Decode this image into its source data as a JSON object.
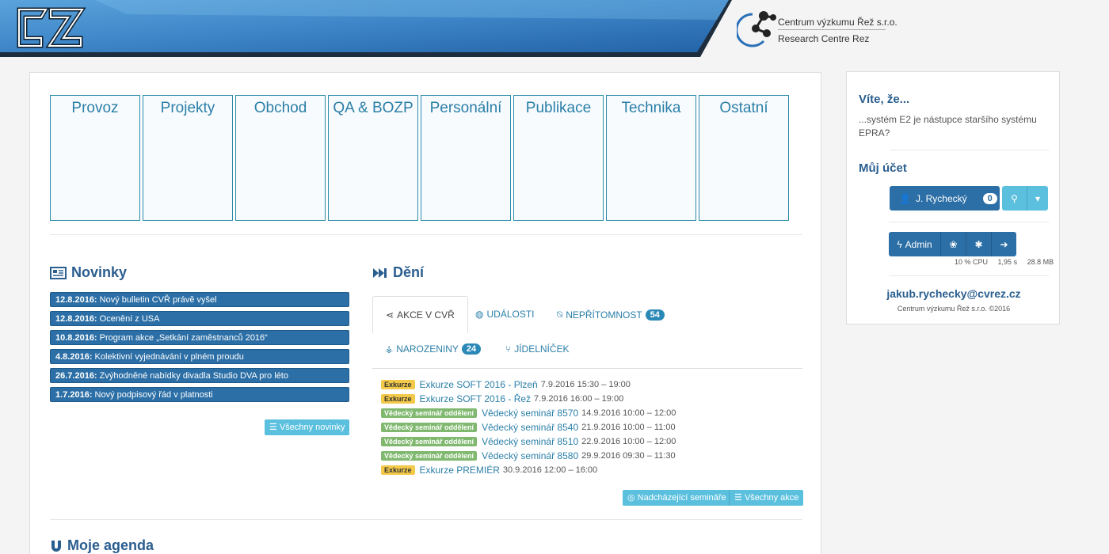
{
  "header": {
    "logo_text": "EZ",
    "partner_name_cz": "Centrum výzkumu Řež s.r.o.",
    "partner_name_en": "Research Centre Rez"
  },
  "tiles": [
    "Provoz",
    "Projekty",
    "Obchod",
    "QA & BOZP",
    "Personální",
    "Publikace",
    "Technika",
    "Ostatní"
  ],
  "novinky": {
    "title": "Novinky",
    "items": [
      {
        "date": "12.8.2016:",
        "text": "Nový bulletin CVŘ právě vyšel"
      },
      {
        "date": "12.8.2016:",
        "text": "Ocenění z USA"
      },
      {
        "date": "10.8.2016:",
        "text": "Program akce „Setkání zaměstnanců 2016“"
      },
      {
        "date": "4.8.2016:",
        "text": "Kolektivní vyjednávání v plném proudu"
      },
      {
        "date": "26.7.2016:",
        "text": "Zvýhodněné nabídky divadla Studio DVA pro léto"
      },
      {
        "date": "1.7.2016:",
        "text": "Nový podpisový řád v platnosti"
      }
    ],
    "all_button": "Všechny novinky"
  },
  "deni": {
    "title": "Dění",
    "tabs": {
      "akce": "AKCE V CVŘ",
      "udalosti": "UDÁLOSTI",
      "nepritomnost": "NEPŘÍTOMNOST",
      "nepritomnost_count": "54",
      "narozeniny": "NAROZENINY",
      "narozeniny_count": "24",
      "jidelnicek": "JÍDELNÍČEK"
    },
    "events": [
      {
        "type": "exk",
        "label": "Exkurze",
        "link": "Exkurze SOFT 2016 - Plzeň",
        "date": "7.9.2016 15:30 – 19:00"
      },
      {
        "type": "exk",
        "label": "Exkurze",
        "link": "Exkurze SOFT 2016 - Řež",
        "date": "7.9.2016 16:00 – 19:00"
      },
      {
        "type": "sem",
        "label": "Vědecký seminář oddělení",
        "link": "Vědecký seminář 8570",
        "date": "14.9.2016 10:00 – 12:00"
      },
      {
        "type": "sem",
        "label": "Vědecký seminář oddělení",
        "link": "Vědecký seminář 8540",
        "date": "21.9.2016 10:00 – 11:00"
      },
      {
        "type": "sem",
        "label": "Vědecký seminář oddělení",
        "link": "Vědecký seminář 8510",
        "date": "22.9.2016 10:00 – 12:00"
      },
      {
        "type": "sem",
        "label": "Vědecký seminář oddělení",
        "link": "Vědecký seminář 8580",
        "date": "29.9.2016 09:30 – 11:30"
      },
      {
        "type": "exk",
        "label": "Exkurze",
        "link": "Exkurze PREMIÉR",
        "date": "30.9.2016 12:00 – 16:00"
      }
    ],
    "upcoming_button": "Nadcházející semináře",
    "all_button": "Všechny akce"
  },
  "agenda": {
    "title": "Moje agenda"
  },
  "sidebar": {
    "vite_title": "Víte, že...",
    "vite_text": "...systém E2 je nástupce staršího systému EPRA?",
    "account_title": "Můj účet",
    "user_name": "J. Rychecký",
    "user_count": "0",
    "admin_label": "Admin",
    "cpu": "10 % CPU",
    "time": "1,95 s",
    "memory": "28.8 MB",
    "email": "jakub.rychecky@cvrez.cz",
    "copyright": "Centrum výzkumu Řež s.r.o. ©2016"
  },
  "colors": {
    "primary": "#2c6fa6",
    "info": "#5bc0de",
    "header_blue": "#3a7cc0"
  }
}
